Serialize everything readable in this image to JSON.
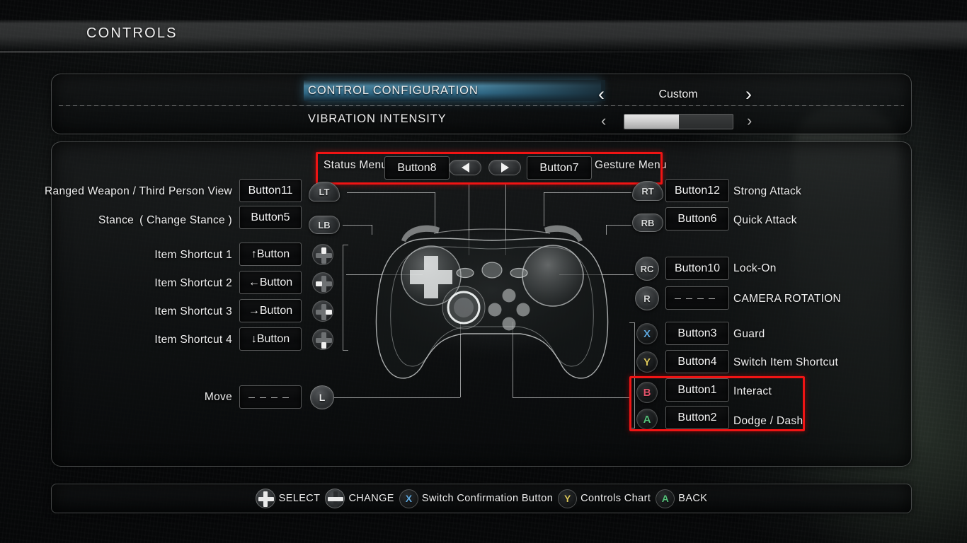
{
  "page": {
    "title": "CONTROLS"
  },
  "config": {
    "rows": [
      {
        "label": "CONTROL CONFIGURATION",
        "value": "Custom",
        "type": "select",
        "highlighted": true
      },
      {
        "label": "VIBRATION INTENSITY",
        "type": "slider",
        "fill_percent": 50
      }
    ],
    "arrow_left": "‹",
    "arrow_right": "›"
  },
  "top_row": {
    "left_label": "Status Menu",
    "left_value": "Button8",
    "dpad_left_icon": "arrow-left-icon",
    "dpad_right_icon": "arrow-right-icon",
    "right_value": "Button7",
    "right_label": "Gesture Menu"
  },
  "left_bindings": [
    {
      "label": "Ranged Weapon / Third Person View",
      "value": "Button11",
      "badge": "LT",
      "badge_shape": "trigger"
    },
    {
      "label": "Stance ( Change Stance )",
      "value": "Button5",
      "badge": "LB",
      "badge_shape": "pill"
    },
    {
      "label": "Item Shortcut 1",
      "value": "↑Button",
      "badge": "dpad-up-icon",
      "badge_shape": "dpad"
    },
    {
      "label": "Item Shortcut 2",
      "value": "←Button",
      "badge": "dpad-left-icon",
      "badge_shape": "dpad"
    },
    {
      "label": "Item Shortcut 3",
      "value": "→Button",
      "badge": "dpad-right-icon",
      "badge_shape": "dpad"
    },
    {
      "label": "Item Shortcut 4",
      "value": "↓Button",
      "badge": "dpad-down-icon",
      "badge_shape": "dpad"
    },
    {
      "label": "Move",
      "value": "",
      "unassigned": true,
      "badge": "L",
      "badge_shape": "stick"
    }
  ],
  "right_bindings": [
    {
      "badge": "RT",
      "badge_shape": "trigger",
      "value": "Button12",
      "label": "Strong Attack"
    },
    {
      "badge": "RB",
      "badge_shape": "pill",
      "value": "Button6",
      "label": "Quick Attack"
    },
    {
      "badge": "RC",
      "badge_shape": "round",
      "value": "Button10",
      "label": "Lock-On"
    },
    {
      "badge": "R",
      "badge_shape": "round",
      "value": "",
      "unassigned": true,
      "label": "CAMERA ROTATION"
    },
    {
      "badge": "X",
      "badge_shape": "face",
      "badge_color": "#5fa8dd",
      "value": "Button3",
      "label": "Guard"
    },
    {
      "badge": "Y",
      "badge_shape": "face",
      "badge_color": "#ddc95c",
      "value": "Button4",
      "label": "Switch Item Shortcut"
    },
    {
      "badge": "B",
      "badge_shape": "face",
      "badge_color": "#e0536a",
      "value": "Button1",
      "label": "Interact",
      "highlighted": true
    },
    {
      "badge": "A",
      "badge_shape": "face",
      "badge_color": "#56c07a",
      "value": "Button2",
      "label": "Dodge / Dash",
      "highlighted": true
    }
  ],
  "footer": [
    {
      "icon": "dpad-updown-icon",
      "label": "SELECT"
    },
    {
      "icon": "dpad-leftright-icon",
      "label": "CHANGE"
    },
    {
      "icon": "x-button-icon",
      "label": "Switch Confirmation Button"
    },
    {
      "icon": "y-button-icon",
      "label": "Controls Chart"
    },
    {
      "icon": "a-button-icon",
      "label": "BACK"
    }
  ],
  "colors": {
    "highlight_red": "#f01414",
    "selection_blue": "#569ec0",
    "text": "#f0f0f0"
  }
}
